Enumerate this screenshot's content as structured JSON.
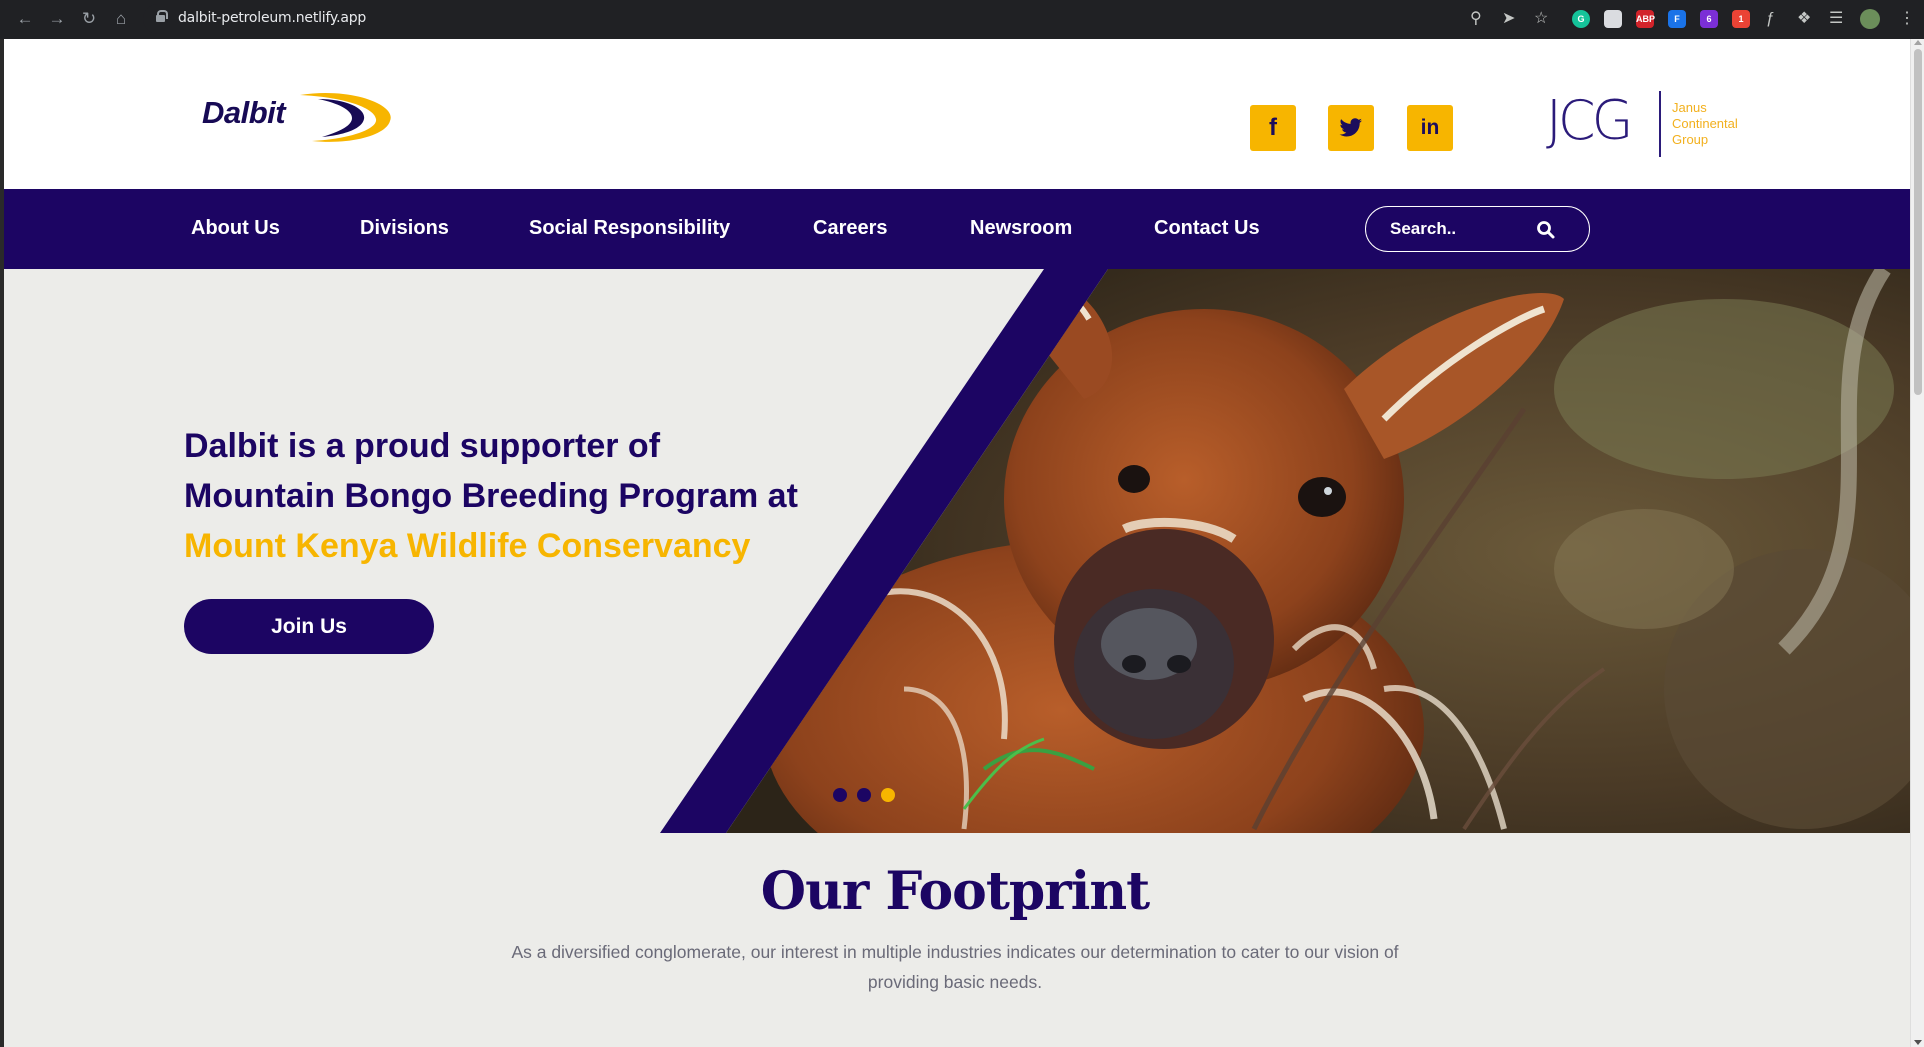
{
  "browser": {
    "url": "dalbit-petroleum.netlify.app",
    "extensions": [
      {
        "name": "grammarly-icon",
        "color": "#15c39a",
        "label": "G"
      },
      {
        "name": "extension-doc-icon",
        "color": "#dadce0",
        "label": ""
      },
      {
        "name": "adblock-icon",
        "color": "#d2232a",
        "label": "ABP"
      },
      {
        "name": "extension-f-icon",
        "color": "#1a73e8",
        "label": "F"
      },
      {
        "name": "extension-purple-icon",
        "color": "#7b2fd6",
        "label": "6"
      },
      {
        "name": "extension-red-icon",
        "color": "#ea4335",
        "label": "1"
      }
    ]
  },
  "header": {
    "logo_text": "Dalbit",
    "social": [
      {
        "name": "facebook-icon",
        "glyph": "f"
      },
      {
        "name": "twitter-icon",
        "glyph": "t"
      },
      {
        "name": "linkedin-icon",
        "glyph": "in"
      }
    ],
    "jcg": {
      "letters": "JCG",
      "line1": "Janus",
      "line2": "Continental",
      "line3": "Group"
    }
  },
  "nav": {
    "items": [
      "About Us",
      "Divisions",
      "Social Responsibility",
      "Careers",
      "Newsroom",
      "Contact Us"
    ],
    "search_placeholder": "Search.."
  },
  "hero": {
    "line1": "Dalbit is a proud supporter of",
    "line2": "Mountain Bongo Breeding Program at",
    "line3": "Mount Kenya Wildlife Conservancy",
    "button_label": "Join Us",
    "slides": 3,
    "active_slide": 3
  },
  "footprint": {
    "title": "Our Footprint",
    "text": "As a diversified conglomerate, our interest in multiple industries indicates our determination to cater to our vision of providing basic needs."
  },
  "colors": {
    "brand_purple": "#1c0563",
    "brand_yellow": "#f7b500",
    "background": "#ecece9"
  }
}
